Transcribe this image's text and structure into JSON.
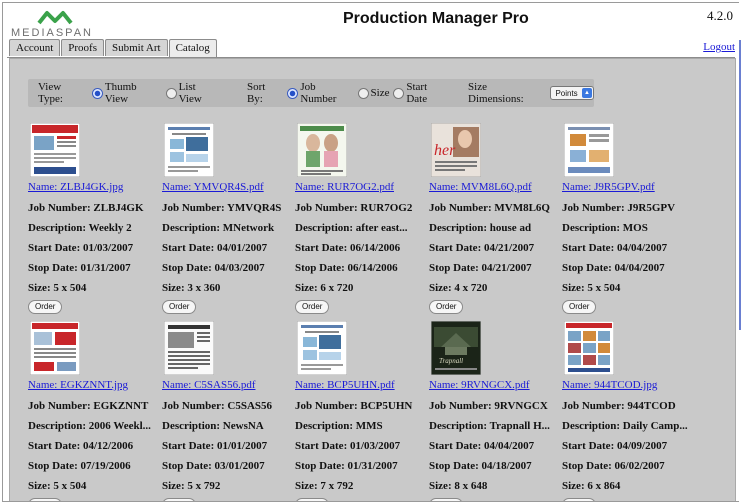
{
  "header": {
    "brand": "MEDIASPAN",
    "title": "Production Manager Pro",
    "version": "4.2.0",
    "logout": "Logout"
  },
  "tabs": [
    {
      "label": "Account",
      "active": false
    },
    {
      "label": "Proofs",
      "active": false
    },
    {
      "label": "Submit Art",
      "active": false
    },
    {
      "label": "Catalog",
      "active": true
    }
  ],
  "controls": {
    "view_label": "View Type:",
    "view_options": [
      {
        "label": "Thumb View",
        "selected": true
      },
      {
        "label": "List View",
        "selected": false
      }
    ],
    "sort_label": "Sort By:",
    "sort_options": [
      {
        "label": "Job Number",
        "selected": true
      },
      {
        "label": "Size",
        "selected": false
      },
      {
        "label": "Start Date",
        "selected": false
      }
    ],
    "dim_label": "Size Dimensions:",
    "dim_value": "Points"
  },
  "items": [
    {
      "name": "Name: ZLBJ4GK.jpg",
      "job": "Job Number: ZLBJ4GK",
      "desc": "Description: Weekly 2",
      "start": "Start Date: 01/03/2007",
      "stop": "Stop Date: 01/31/2007",
      "size": "Size: 5 x 504",
      "order": "Order",
      "thumb": "red-ad"
    },
    {
      "name": "Name: YMVQR4S.pdf",
      "job": "Job Number: YMVQR4S",
      "desc": "Description: MNetwork",
      "start": "Start Date: 04/01/2007",
      "stop": "Stop Date: 04/03/2007",
      "size": "Size: 3 x 360",
      "order": "Order",
      "thumb": "blue-flyer"
    },
    {
      "name": "Name: RUR7OG2.pdf",
      "job": "Job Number: RUR7OG2",
      "desc": "Description: after east...",
      "start": "Start Date: 06/14/2006",
      "stop": "Stop Date: 06/14/2006",
      "size": "Size: 6 x 720",
      "order": "Order",
      "thumb": "fashion-ad"
    },
    {
      "name": "Name: MVM8L6Q.pdf",
      "job": "Job Number: MVM8L6Q",
      "desc": "Description: house ad",
      "start": "Start Date: 04/21/2007",
      "stop": "Stop Date: 04/21/2007",
      "size": "Size: 4 x 720",
      "order": "Order",
      "thumb": "her-ad"
    },
    {
      "name": "Name: J9R5GPV.pdf",
      "job": "Job Number: J9R5GPV",
      "desc": "Description: MOS",
      "start": "Start Date: 04/04/2007",
      "stop": "Stop Date: 04/04/2007",
      "size": "Size: 5 x 504",
      "order": "Order",
      "thumb": "orange-flyer"
    },
    {
      "name": "Name: EGKZNNT.jpg",
      "job": "Job Number: EGKZNNT",
      "desc": "Description: 2006 Weekl...",
      "start": "Start Date: 04/12/2006",
      "stop": "Stop Date: 07/19/2006",
      "size": "Size: 5 x 504",
      "order": "Order",
      "thumb": "red-listing"
    },
    {
      "name": "Name: C5SAS56.pdf",
      "job": "Job Number: C5SAS56",
      "desc": "Description: NewsNA",
      "start": "Start Date: 01/01/2007",
      "stop": "Stop Date: 03/01/2007",
      "size": "Size: 5 x 792",
      "order": "Order",
      "thumb": "news-page"
    },
    {
      "name": "Name: BCP5UHN.pdf",
      "job": "Job Number: BCP5UHN",
      "desc": "Description: MMS",
      "start": "Start Date: 01/03/2007",
      "stop": "Stop Date: 01/31/2007",
      "size": "Size: 7 x 792",
      "order": "Order",
      "thumb": "blue-flyer"
    },
    {
      "name": "Name: 9RVNGCX.pdf",
      "job": "Job Number: 9RVNGCX",
      "desc": "Description: Trapnall H...",
      "start": "Start Date: 04/04/2007",
      "stop": "Stop Date: 04/18/2007",
      "size": "Size: 8 x 648",
      "order": "Order",
      "thumb": "dark-house"
    },
    {
      "name": "Name: 944TCOD.jpg",
      "job": "Job Number: 944TCOD",
      "desc": "Description: Daily Camp...",
      "start": "Start Date: 04/09/2007",
      "stop": "Stop Date: 06/02/2007",
      "size": "Size: 6 x 864",
      "order": "Order",
      "thumb": "grid-listing"
    }
  ]
}
